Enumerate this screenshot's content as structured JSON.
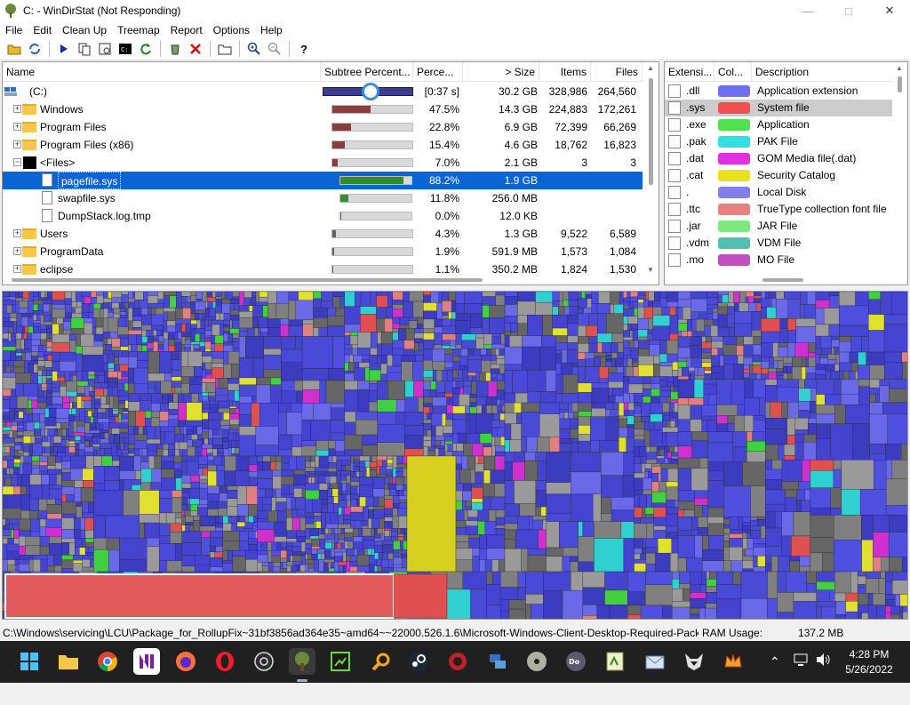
{
  "window": {
    "title": "C: - WinDirStat (Not Responding)"
  },
  "menu": [
    "File",
    "Edit",
    "Clean Up",
    "Treemap",
    "Report",
    "Options",
    "Help"
  ],
  "tree": {
    "columns": [
      "Name",
      "Subtree Percent...",
      "Perce...",
      "> Size",
      "Items",
      "Files"
    ],
    "rows": [
      {
        "name": "(C:)",
        "icon": "drive-icon",
        "depth": 0,
        "expander": "",
        "percent": "[0:37 s]",
        "fraction": 1.0,
        "color": "#3c3c96",
        "size": "30.2 GB",
        "items": "328,986",
        "files": "264,560"
      },
      {
        "name": "Windows",
        "icon": "folder-icon",
        "depth": 1,
        "expander": "+",
        "percent": "47.5%",
        "fraction": 0.475,
        "color": "#8c3c3c",
        "size": "14.3 GB",
        "items": "224,883",
        "files": "172,261"
      },
      {
        "name": "Program Files",
        "icon": "folder-icon",
        "depth": 1,
        "expander": "+",
        "percent": "22.8%",
        "fraction": 0.228,
        "color": "#8c3c3c",
        "size": "6.9 GB",
        "items": "72,399",
        "files": "66,269"
      },
      {
        "name": "Program Files (x86)",
        "icon": "folder-icon",
        "depth": 1,
        "expander": "+",
        "percent": "15.4%",
        "fraction": 0.154,
        "color": "#8c3c3c",
        "size": "4.6 GB",
        "items": "18,762",
        "files": "16,823"
      },
      {
        "name": "<Files>",
        "icon": "files-icon",
        "depth": 1,
        "expander": "−",
        "percent": "7.0%",
        "fraction": 0.07,
        "color": "#8c3c3c",
        "size": "2.1 GB",
        "items": "3",
        "files": "3"
      },
      {
        "name": "pagefile.sys",
        "icon": "file-icon",
        "depth": 2,
        "expander": "",
        "percent": "88.2%",
        "fraction": 0.882,
        "color": "#2f8f2f",
        "size": "1.9 GB",
        "items": "",
        "files": "",
        "selected": true
      },
      {
        "name": "swapfile.sys",
        "icon": "file-icon",
        "depth": 2,
        "expander": "",
        "percent": "11.8%",
        "fraction": 0.118,
        "color": "#2f8f2f",
        "size": "256.0 MB",
        "items": "",
        "files": ""
      },
      {
        "name": "DumpStack.log.tmp",
        "icon": "file-icon",
        "depth": 2,
        "expander": "",
        "percent": "0.0%",
        "fraction": 0.0,
        "color": "#2f8f2f",
        "size": "12.0 KB",
        "items": "",
        "files": ""
      },
      {
        "name": "Users",
        "icon": "folder-icon",
        "depth": 1,
        "expander": "+",
        "percent": "4.3%",
        "fraction": 0.043,
        "color": "#606060",
        "size": "1.3 GB",
        "items": "9,522",
        "files": "6,589"
      },
      {
        "name": "ProgramData",
        "icon": "folder-icon",
        "depth": 1,
        "expander": "+",
        "percent": "1.9%",
        "fraction": 0.019,
        "color": "#606060",
        "size": "591.9 MB",
        "items": "1,573",
        "files": "1,084"
      },
      {
        "name": "eclipse",
        "icon": "folder-icon",
        "depth": 1,
        "expander": "+",
        "percent": "1.1%",
        "fraction": 0.011,
        "color": "#606060",
        "size": "350.2 MB",
        "items": "1,824",
        "files": "1,530"
      }
    ]
  },
  "extensions": {
    "columns": [
      "Extensi...",
      "Col...",
      "Description"
    ],
    "rows": [
      {
        "ext": ".dll",
        "color": "#7070f0",
        "desc": "Application extension"
      },
      {
        "ext": ".sys",
        "color": "#f05050",
        "desc": "System file",
        "selected": true
      },
      {
        "ext": ".exe",
        "color": "#50e050",
        "desc": "Application"
      },
      {
        "ext": ".pak",
        "color": "#30e0e0",
        "desc": "PAK File"
      },
      {
        "ext": ".dat",
        "color": "#e030e0",
        "desc": "GOM Media file(.dat)"
      },
      {
        "ext": ".cat",
        "color": "#e8e020",
        "desc": "Security Catalog"
      },
      {
        "ext": ".",
        "color": "#8080e8",
        "desc": "Local Disk"
      },
      {
        "ext": ".ttc",
        "color": "#e88080",
        "desc": "TrueType collection font file"
      },
      {
        "ext": ".jar",
        "color": "#80e880",
        "desc": "JAR File"
      },
      {
        "ext": ".vdm",
        "color": "#50c0b0",
        "desc": "VDM File"
      },
      {
        "ext": ".mo",
        "color": "#c050c0",
        "desc": "MO File"
      }
    ]
  },
  "status": {
    "path": "C:\\Windows\\servicing\\LCU\\Package_for_RollupFix~31bf3856ad364e35~amd64~~22000.526.1.6\\Microsoft-Windows-Client-Desktop-Required-Packa",
    "ram_label": "RAM Usage:",
    "ram_value": "137.2 MB"
  },
  "taskbar": {
    "time": "4:28 PM",
    "date": "5/26/2022"
  },
  "colors": {
    "selection": "#0a64d2",
    "treemap_blue": "#4848d8",
    "treemap_red": "#e05050",
    "treemap_green": "#40d040"
  }
}
